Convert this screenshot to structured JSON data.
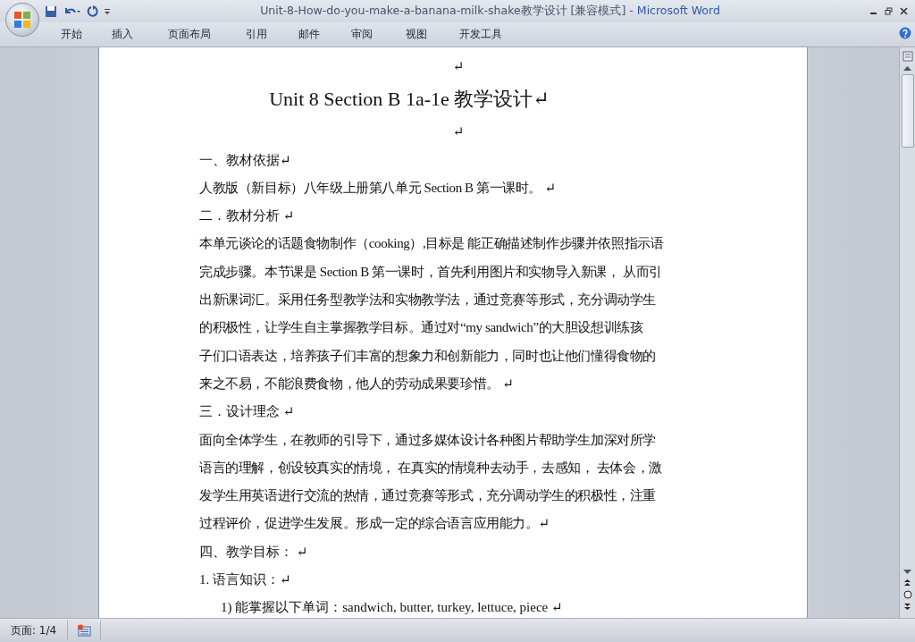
{
  "window": {
    "title": "Unit-8-How-do-you-make-a-banana-milk-shake教学设计 [兼容模式]",
    "separator": "-",
    "app_name": "Microsoft Word"
  },
  "ribbon_tabs": [
    {
      "label": "开始",
      "selected": false
    },
    {
      "label": "插入",
      "selected": false
    },
    {
      "label": "页面布局",
      "selected": false
    },
    {
      "label": "引用",
      "selected": false
    },
    {
      "label": "邮件",
      "selected": false
    },
    {
      "label": "审阅",
      "selected": false
    },
    {
      "label": "视图",
      "selected": false
    },
    {
      "label": "开发工具",
      "selected": false
    }
  ],
  "document": {
    "paragraphs": [
      {
        "kind": "mark",
        "text": "↵"
      },
      {
        "kind": "title",
        "text": "Unit 8 Section B    1a-1e  教学设计↵"
      },
      {
        "kind": "mark",
        "text": "↵"
      },
      {
        "kind": "heading",
        "text": "一、教材依据↵"
      },
      {
        "kind": "body",
        "text": "人教版（新目标）八年级上册第八单元 Section B 第一课时。 ↵"
      },
      {
        "kind": "heading",
        "text": "二．教材分析 ↵"
      },
      {
        "kind": "body",
        "lines": [
          "本单元谈论的话题食物制作（cooking）,目标是 能正确描述制作步骤并依照指示语",
          "完成步骤。本节课是 Section B 第一课时，首先利用图片和实物导入新课， 从而引",
          "出新课词汇。采用任务型教学法和实物教学法，通过竞赛等形式，充分调动学生",
          "的积极性，让学生自主掌握教学目标。通过对“my sandwich”的大胆设想训练孩",
          "子们口语表达，培养孩子们丰富的想象力和创新能力，同时也让他们懂得食物的",
          "来之不易，不能浪费食物，他人的劳动成果要珍惜。 ↵"
        ]
      },
      {
        "kind": "heading",
        "text": "三．设计理念     ↵"
      },
      {
        "kind": "body",
        "lines": [
          "面向全体学生，在教师的引导下，通过多媒体设计各种图片帮助学生加深对所学",
          "语言的理解，创设较真实的情境， 在真实的情境种去动手，去感知， 去体会，激",
          "发学生用英语进行交流的热情，通过竞赛等形式，充分调动学生的积极性，注重",
          "过程评价，促进学生发展。形成一定的综合语言应用能力。↵"
        ]
      },
      {
        "kind": "heading",
        "text": "四、教学目标： ↵"
      },
      {
        "kind": "heading",
        "text": "1. 语言知识：↵"
      },
      {
        "kind": "indent",
        "text": "1) 能掌握以下单词：sandwich, butter, turkey, lettuce, piece  ↵"
      }
    ]
  },
  "status_bar": {
    "page": "页面: 1/4"
  }
}
